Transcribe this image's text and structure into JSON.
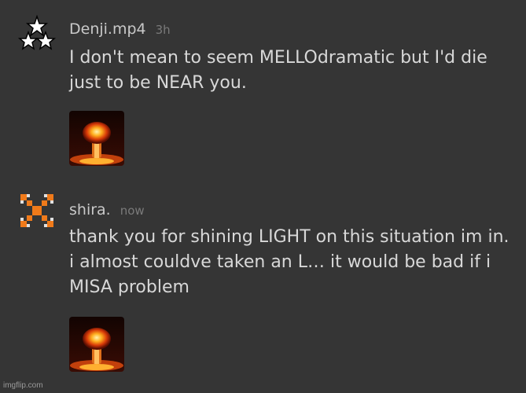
{
  "posts": [
    {
      "username": "Denji.mp4",
      "time": "3h",
      "message": "I don't mean to seem MELLOdramatic but I'd die just to be NEAR you.",
      "avatar_icon": "three-stars-icon",
      "attachment_icon": "nuclear-explosion-image"
    },
    {
      "username": "shira.",
      "time": "now",
      "message": "thank you for shining LIGHT on this situation im in. i almost couldve taken an L… it would be bad if i MISA problem",
      "avatar_icon": "orange-x-icon",
      "attachment_icon": "nuclear-explosion-image"
    }
  ],
  "watermark": "imgflip.com",
  "colors": {
    "background": "#353535",
    "username": "#c9c9c9",
    "timestamp": "#7a7a7a",
    "message": "#d8d8d8",
    "avatar_orange": "#f07a1a"
  }
}
